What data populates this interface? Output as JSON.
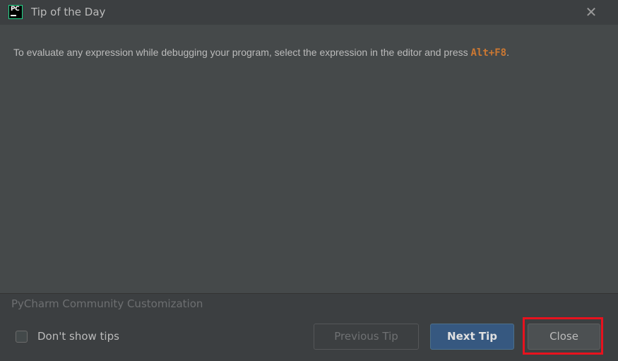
{
  "window": {
    "title": "Tip of the Day",
    "app_icon_text": "PC",
    "close_glyph": "✕"
  },
  "tip": {
    "text_before": "To evaluate any expression while debugging your program, select the expression in the editor and press ",
    "shortcut": "Alt+F8",
    "text_after": "."
  },
  "footer": {
    "source": "PyCharm Community Customization",
    "checkbox_label": "Don't show tips",
    "checkbox_checked": false,
    "previous_button": "Previous Tip",
    "previous_enabled": false,
    "next_button": "Next Tip",
    "close_button": "Close"
  },
  "colors": {
    "background": "#3c3f41",
    "content_background": "#45494a",
    "text": "#bbbbbb",
    "shortcut": "#cc7832",
    "default_button": "#365880",
    "highlight": "#e8121e"
  },
  "icons": {
    "app": "pycharm-logo-icon",
    "close": "close-icon",
    "checkbox": "checkbox-unchecked-icon"
  }
}
